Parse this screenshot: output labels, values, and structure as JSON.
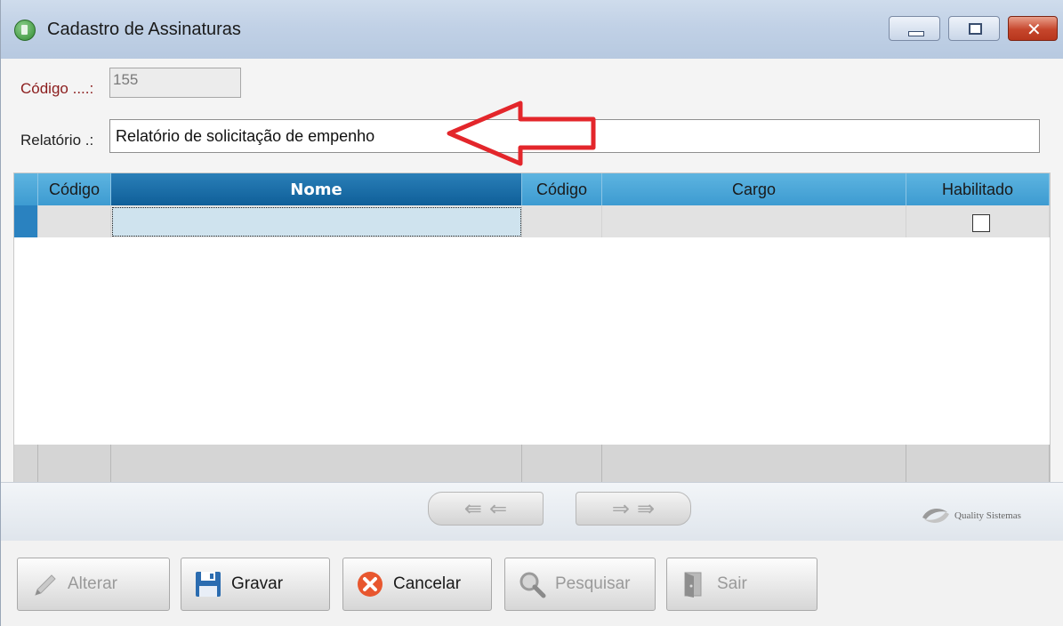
{
  "window": {
    "title": "Cadastro de Assinaturas",
    "icon": "app-icon",
    "controls": [
      "minimize-button",
      "maximize-button",
      "close-button"
    ]
  },
  "form": {
    "codigo_label": "Código ....:",
    "codigo_value": "155",
    "relatorio_label": "Relatório .:",
    "relatorio_value": "Relatório de solicitação de empenho"
  },
  "grid": {
    "columns": [
      "Código",
      "Nome",
      "Código",
      "Cargo",
      "Habilitado"
    ],
    "selected_column": "Nome",
    "rows": [
      {
        "codigo": "",
        "nome": "",
        "codigo2": "",
        "cargo": "",
        "habilitado": false
      }
    ]
  },
  "nav": {
    "prev_icons": [
      "first-record-icon",
      "previous-record-icon"
    ],
    "next_icons": [
      "next-record-icon",
      "last-record-icon"
    ],
    "brand": "Quality Sistemas"
  },
  "toolbar": {
    "alterar": "Alterar",
    "gravar": "Gravar",
    "cancelar": "Cancelar",
    "pesquisar": "Pesquisar",
    "sair": "Sair"
  },
  "colors": {
    "header_blue": "#3d9bd1",
    "header_selected": "#0f5f99",
    "annotation_arrow": "#e3262b",
    "label_red": "#8b1c1c"
  }
}
